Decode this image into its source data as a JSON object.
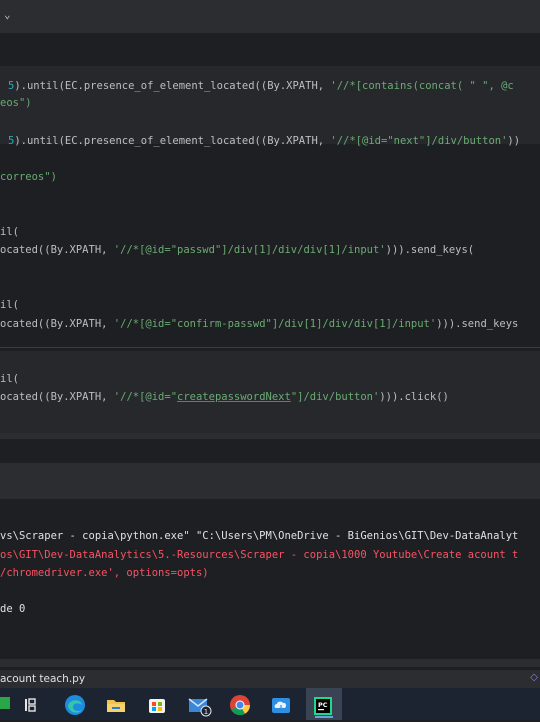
{
  "editor": {
    "lines": [
      {
        "id": "l1",
        "parts": [
          {
            "t": "5",
            "c": "num"
          },
          {
            "t": ").until(EC.presence_of_element_located((By.XPATH, "
          },
          {
            "t": "'//*[contains(concat( \" \", @c",
            "c": "str"
          }
        ]
      },
      {
        "id": "l2",
        "parts": [
          {
            "t": "eos\")",
            "c": "str"
          }
        ]
      },
      {
        "id": "l3",
        "parts": [
          {
            "t": "5",
            "c": "num"
          },
          {
            "t": ").until(EC.presence_of_element_located((By.XPATH, "
          },
          {
            "t": "'//*[@id=\"next\"]/div/button'",
            "c": "str"
          },
          {
            "t": "))"
          }
        ]
      },
      {
        "id": "l4",
        "parts": [
          {
            "t": "correos\")",
            "c": "str"
          }
        ]
      },
      {
        "id": "l5",
        "parts": [
          {
            "t": "il("
          }
        ]
      },
      {
        "id": "l6",
        "parts": [
          {
            "t": "ocated((By.XPATH, "
          },
          {
            "t": "'//*[@id=\"passwd\"]/div[1]/div/div[1]/input'",
            "c": "str"
          },
          {
            "t": "))).send_keys("
          }
        ]
      },
      {
        "id": "l7",
        "parts": [
          {
            "t": "il("
          }
        ]
      },
      {
        "id": "l8",
        "parts": [
          {
            "t": "ocated((By.XPATH, "
          },
          {
            "t": "'//*[@id=\"confirm-passwd\"]/div[1]/div/div[1]/input'",
            "c": "str"
          },
          {
            "t": "))).send_keys"
          }
        ]
      },
      {
        "id": "l9",
        "parts": [
          {
            "t": "il("
          }
        ]
      },
      {
        "id": "l10",
        "parts": [
          {
            "t": "ocated((By.XPATH, "
          },
          {
            "t": "'//*[@id=\"",
            "c": "str"
          },
          {
            "t": "createpasswordNext",
            "c": "str u"
          },
          {
            "t": "\"]/div/button'",
            "c": "str"
          },
          {
            "t": "))).click()"
          }
        ]
      }
    ]
  },
  "console": {
    "lines": [
      {
        "id": "c1",
        "text": "vs\\Scraper - copia\\python.exe\" \"C:\\Users\\PM\\OneDrive - BiGenios\\GIT\\Dev-DataAnalyt",
        "color": "#dfe1e5"
      },
      {
        "id": "c2",
        "text": "os\\GIT\\Dev-DataAnalytics\\5.-Resources\\Scraper - copia\\1000 Youtube\\Create acount t",
        "color": "#f75464"
      },
      {
        "id": "c3",
        "text": "/chromedriver.exe', options=opts)",
        "color": "#f75464"
      },
      {
        "id": "c4",
        "text": "de 0",
        "color": "#dfe1e5"
      }
    ]
  },
  "statusbar": {
    "file": "acount teach.py"
  },
  "taskbar": {
    "icons": [
      {
        "name": "task-view-icon"
      },
      {
        "name": "edge-icon"
      },
      {
        "name": "file-explorer-icon"
      },
      {
        "name": "microsoft-store-icon"
      },
      {
        "name": "mail-icon",
        "badge": "1"
      },
      {
        "name": "chrome-icon"
      },
      {
        "name": "cloud-app-icon"
      },
      {
        "name": "pycharm-icon"
      }
    ]
  },
  "colors": {
    "keyword_num": "#2aacb8",
    "string": "#6aab73",
    "text": "#bcbec4",
    "error": "#f75464",
    "bg": "#1e1f22",
    "taskbar": "#1c2431"
  }
}
